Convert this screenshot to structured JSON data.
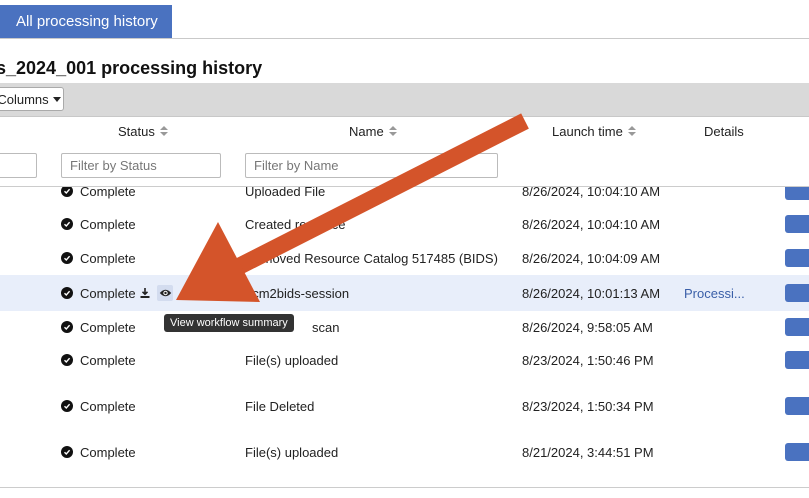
{
  "tabs": {
    "active_label": "All processing history"
  },
  "page": {
    "title": "s_2024_001 processing history"
  },
  "toolbar": {
    "columns_label": "Columns"
  },
  "columns": {
    "status": "Status",
    "name": "Name",
    "launch_time": "Launch time",
    "details": "Details"
  },
  "filters": {
    "status_placeholder": "Filter by Status",
    "name_placeholder": "Filter by Name"
  },
  "tooltip": {
    "text": "View workflow summary"
  },
  "rows": [
    {
      "status": "Complete",
      "name": "Uploaded File",
      "time": "8/26/2024, 10:04:10 AM",
      "details": ""
    },
    {
      "status": "Complete",
      "name": "Created resource",
      "time": "8/26/2024, 10:04:10 AM",
      "details": ""
    },
    {
      "status": "Complete",
      "name": "Removed Resource Catalog 517485 (BIDS)",
      "time": "8/26/2024, 10:04:09 AM",
      "details": ""
    },
    {
      "status": "Complete",
      "name": "dcm2bids-session",
      "time": "8/26/2024, 10:01:13 AM",
      "details": "Processi..."
    },
    {
      "status": "Complete",
      "name": "scan",
      "time": "8/26/2024, 9:58:05 AM",
      "details": ""
    },
    {
      "status": "Complete",
      "name": "File(s) uploaded",
      "time": "8/23/2024, 1:50:46 PM",
      "details": ""
    },
    {
      "status": "Complete",
      "name": "File Deleted",
      "time": "8/23/2024, 1:50:34 PM",
      "details": ""
    },
    {
      "status": "Complete",
      "name": "File(s) uploaded",
      "time": "8/21/2024, 3:44:51 PM",
      "details": ""
    }
  ],
  "colors": {
    "accent": "#4a72c0",
    "annotation_arrow": "#d4542a",
    "row_highlight": "#e8eefa"
  },
  "icons": {
    "status": "check-circle-icon",
    "download": "download-icon",
    "view": "eye-icon",
    "sort": "sort-icon"
  }
}
